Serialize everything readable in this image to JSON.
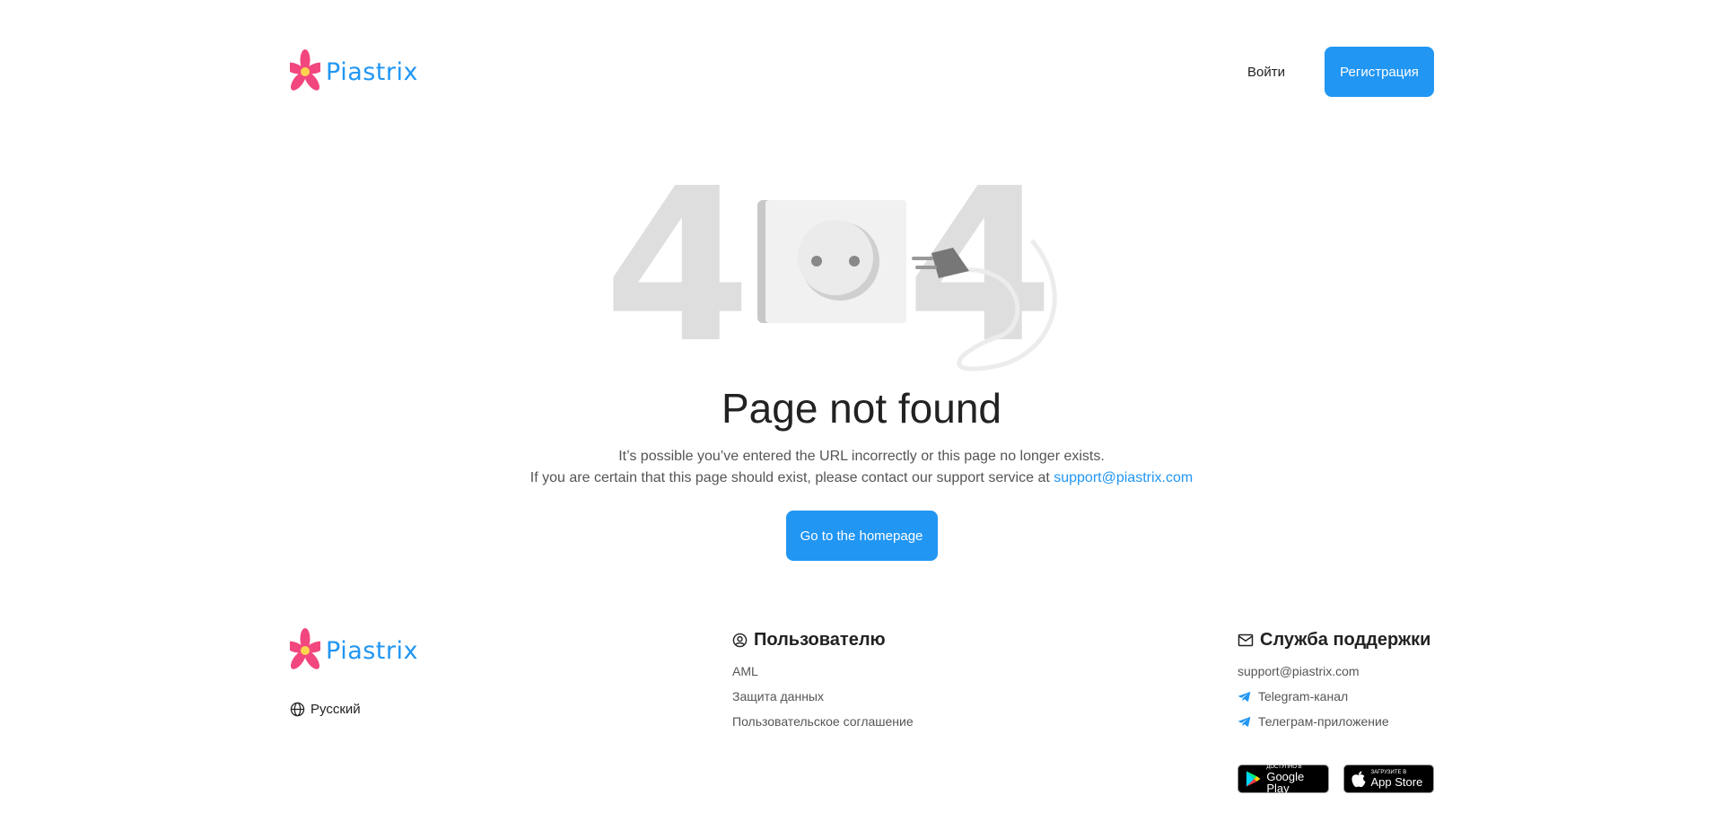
{
  "brand": {
    "name": "Piastrix"
  },
  "header": {
    "login_label": "Войти",
    "register_label": "Регистрация"
  },
  "main": {
    "digit_left": "4",
    "digit_right": "4",
    "title": "Page not found",
    "desc_line1": "It’s possible you’ve entered the URL incorrectly or this page no longer exists.",
    "desc_line2": "If you are certain that this page should exist, please contact our support service at ",
    "support_email": "support@piastrix.com",
    "home_button": "Go to the homepage"
  },
  "footer": {
    "language": "Русский",
    "user": {
      "heading": "Пользователю",
      "links": [
        "AML",
        "Защита данных",
        "Пользовательское соглашение"
      ]
    },
    "support": {
      "heading": "Служба поддержки",
      "email": "support@piastrix.com",
      "telegram_channel": "Telegram-канал",
      "telegram_app": "Телеграм-приложение"
    },
    "stores": {
      "google_small": "ДОСТУПНО В",
      "google_big": "Google Play",
      "apple_small": "Загрузите в",
      "apple_big": "App Store"
    }
  },
  "colors": {
    "accent": "#2196f3",
    "logo_petal": "#f2477e",
    "logo_center": "#ffd54f",
    "digit_gray": "#dedede"
  }
}
